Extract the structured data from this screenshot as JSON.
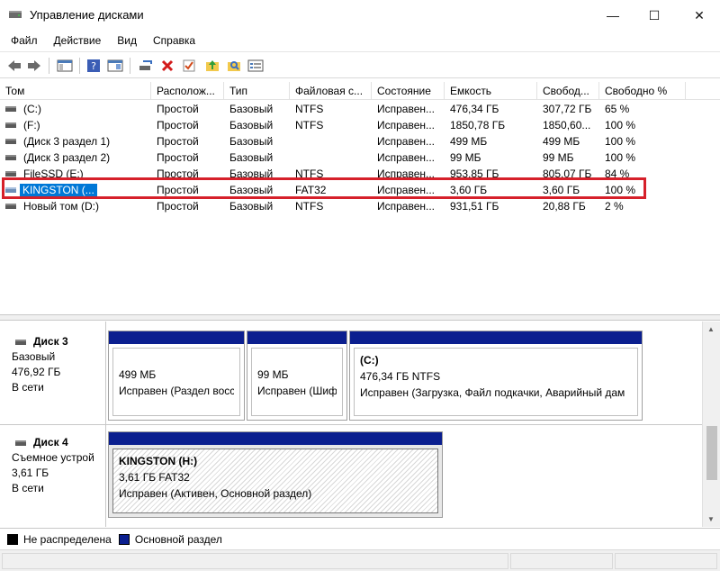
{
  "window": {
    "title": "Управление дисками",
    "controls": {
      "minimize": "—",
      "maximize": "☐",
      "close": "✕"
    }
  },
  "menu": [
    "Файл",
    "Действие",
    "Вид",
    "Справка"
  ],
  "toolbar": {
    "icons": [
      "back-icon",
      "forward-icon",
      "console-tree-icon",
      "help-icon",
      "properties-icon",
      "connect-disk-icon",
      "delete-icon",
      "check-icon",
      "up-folder-icon",
      "search-icon",
      "list-icon"
    ]
  },
  "volume_list": {
    "columns": [
      "Том",
      "Располож...",
      "Тип",
      "Файловая с...",
      "Состояние",
      "Емкость",
      "Свобод...",
      "Свободно %"
    ],
    "rows": [
      {
        "name": "(C:)",
        "layout": "Простой",
        "type": "Базовый",
        "fs": "NTFS",
        "status": "Исправен...",
        "capacity": "476,34 ГБ",
        "free": "307,72 ГБ",
        "free_pct": "65 %"
      },
      {
        "name": "(F:)",
        "layout": "Простой",
        "type": "Базовый",
        "fs": "NTFS",
        "status": "Исправен...",
        "capacity": "1850,78 ГБ",
        "free": "1850,60...",
        "free_pct": "100 %"
      },
      {
        "name": "(Диск 3 раздел 1)",
        "layout": "Простой",
        "type": "Базовый",
        "fs": "",
        "status": "Исправен...",
        "capacity": "499 МБ",
        "free": "499 МБ",
        "free_pct": "100 %"
      },
      {
        "name": "(Диск 3 раздел 2)",
        "layout": "Простой",
        "type": "Базовый",
        "fs": "",
        "status": "Исправен...",
        "capacity": "99 МБ",
        "free": "99 МБ",
        "free_pct": "100 %"
      },
      {
        "name": "FileSSD (E:)",
        "layout": "Простой",
        "type": "Базовый",
        "fs": "NTFS",
        "status": "Исправен...",
        "capacity": "953,85 ГБ",
        "free": "805,07 ГБ",
        "free_pct": "84 %"
      },
      {
        "name": "KINGSTON (...",
        "layout": "Простой",
        "type": "Базовый",
        "fs": "FAT32",
        "status": "Исправен...",
        "capacity": "3,60 ГБ",
        "free": "3,60 ГБ",
        "free_pct": "100 %"
      },
      {
        "name": "Новый том (D:)",
        "layout": "Простой",
        "type": "Базовый",
        "fs": "NTFS",
        "status": "Исправен...",
        "capacity": "931,51 ГБ",
        "free": "20,88 ГБ",
        "free_pct": "2 %"
      }
    ]
  },
  "disks": [
    {
      "name": "Диск 3",
      "type": "Базовый",
      "size": "476,92 ГБ",
      "state": "В сети",
      "partitions": [
        {
          "title": "",
          "size": "499 МБ",
          "status": "Исправен (Раздел восс"
        },
        {
          "title": "",
          "size": "99 МБ",
          "status": "Исправен (Шифр"
        },
        {
          "title": "(C:)",
          "size": "476,34 ГБ NTFS",
          "status": "Исправен (Загрузка, Файл подкачки, Аварийный дам"
        }
      ]
    },
    {
      "name": "Диск 4",
      "type": "Съемное устрой",
      "size": "3,61 ГБ",
      "state": "В сети",
      "partitions": [
        {
          "title": "KINGSTON  (H:)",
          "size": "3,61 ГБ FAT32",
          "status": "Исправен (Активен, Основной раздел)"
        }
      ]
    }
  ],
  "legend": [
    {
      "label": "Не распределена",
      "color": "#000000"
    },
    {
      "label": "Основной раздел",
      "color": "#0b1f8f"
    }
  ],
  "colors": {
    "selection": "#0078d7",
    "primary_partition": "#0b1f8f",
    "highlight": "#d6202a"
  }
}
